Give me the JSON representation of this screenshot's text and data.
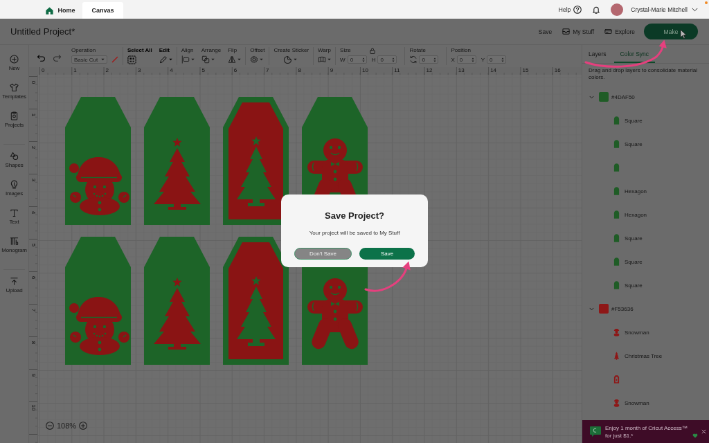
{
  "top_bar": {
    "tabs": [
      {
        "kind": "home",
        "label": "Home",
        "selected": false
      },
      {
        "kind": "canvas",
        "label": "Canvas",
        "selected": true
      }
    ],
    "help": "Help",
    "user_name": "Crystal-Marie Mitchell"
  },
  "project_bar": {
    "title": "Untitled Project*",
    "actions": [
      {
        "kind": "save",
        "label": "Save"
      },
      {
        "kind": "my_stuff",
        "label": "My Stuff"
      },
      {
        "kind": "explore",
        "label": "Explore"
      }
    ],
    "make_button": "Make"
  },
  "toolbar": {
    "history": [
      {
        "kind": "undo",
        "disabled": false
      },
      {
        "kind": "redo",
        "disabled": true
      }
    ],
    "sections": [
      {
        "tools": [
          {
            "kind": "operation",
            "label": "Operation",
            "disabled": true,
            "value": "Basic Cut"
          }
        ]
      },
      {
        "tools": [
          {
            "kind": "select_all",
            "label": "Select All",
            "disabled": false
          },
          {
            "kind": "edit",
            "label": "Edit",
            "disabled": false
          }
        ]
      },
      {
        "tools": [
          {
            "kind": "align",
            "label": "Align",
            "disabled": true
          },
          {
            "kind": "arrange",
            "label": "Arrange",
            "disabled": true
          },
          {
            "kind": "flip",
            "label": "Flip",
            "disabled": true
          }
        ]
      },
      {
        "tools": [
          {
            "kind": "offset",
            "label": "Offset",
            "disabled": true
          }
        ]
      },
      {
        "tools": [
          {
            "kind": "sticker",
            "label": "Create Sticker",
            "disabled": true
          }
        ]
      },
      {
        "tools": [
          {
            "kind": "warp",
            "label": "Warp",
            "disabled": true
          }
        ]
      },
      {
        "tools": [
          {
            "kind": "size",
            "label": "Size",
            "disabled": true,
            "fields": [
              {
                "prefix": "W",
                "value": "0"
              },
              {
                "prefix": "H",
                "value": "0"
              }
            ]
          }
        ]
      },
      {
        "tools": [
          {
            "kind": "rotate",
            "label": "Rotate",
            "disabled": true,
            "fields": [
              {
                "value": "0"
              }
            ]
          }
        ]
      },
      {
        "tools": [
          {
            "kind": "position",
            "label": "Position",
            "disabled": true,
            "fields": [
              {
                "prefix": "X",
                "value": "0"
              },
              {
                "prefix": "Y",
                "value": "0"
              }
            ]
          }
        ]
      }
    ]
  },
  "sidebar": {
    "sections": [
      {
        "items": [
          {
            "kind": "new",
            "label": "New"
          },
          {
            "kind": "templates",
            "label": "Templates"
          },
          {
            "kind": "projects",
            "label": "Projects"
          }
        ]
      },
      {
        "items": [
          {
            "kind": "shapes",
            "label": "Shapes"
          },
          {
            "kind": "images",
            "label": "Images"
          },
          {
            "kind": "text",
            "label": "Text"
          },
          {
            "kind": "monogram",
            "label": "Monogram"
          }
        ]
      },
      {
        "items": [
          {
            "kind": "upload",
            "label": "Upload"
          }
        ]
      }
    ]
  },
  "rulers": {
    "horizontal": [
      "0",
      "1",
      "2",
      "3",
      "4",
      "5",
      "6",
      "7",
      "8",
      "9",
      "10",
      "11",
      "12",
      "13",
      "14",
      "15",
      "16"
    ],
    "vertical": [
      "0",
      "1",
      "2",
      "3",
      "4",
      "5",
      "6",
      "7",
      "8",
      "9",
      "10"
    ]
  },
  "canvas": {
    "tags": [
      {
        "kind": "snowman"
      },
      {
        "kind": "tree"
      },
      {
        "kind": "framed_tree"
      },
      {
        "kind": "gingerbread"
      },
      {
        "kind": "snowman"
      },
      {
        "kind": "tree"
      },
      {
        "kind": "framed_tree"
      },
      {
        "kind": "gingerbread"
      }
    ],
    "zoom": "108%"
  },
  "dialog": {
    "title": "Save Project?",
    "message": "Your project will be saved to My Stuff",
    "buttons": [
      {
        "kind": "dont_save",
        "label": "Don't Save"
      },
      {
        "kind": "save",
        "label": "Save"
      }
    ]
  },
  "panel": {
    "tabs": [
      {
        "label": "Layers",
        "selected": false
      },
      {
        "label": "Color Sync",
        "selected": true
      }
    ],
    "hint": "Drag and drop layers to consolidate material colors.",
    "groups": [
      {
        "name": "#4DAF50",
        "color": "#1f5c26",
        "expanded": true,
        "layers": [
          {
            "kind": "tag",
            "label": "Square"
          },
          {
            "kind": "tag",
            "label": "Square"
          },
          {
            "kind": "tag"
          },
          {
            "kind": "tag",
            "label": "Hexagon"
          },
          {
            "kind": "tag",
            "label": "Hexagon"
          },
          {
            "kind": "tag",
            "label": "Square"
          },
          {
            "kind": "tag",
            "label": "Square"
          },
          {
            "kind": "tag",
            "label": "Square"
          }
        ]
      },
      {
        "name": "#F53636",
        "color": "#8e1717",
        "expanded": true,
        "layers": [
          {
            "kind": "snowman",
            "label": "Snowman"
          },
          {
            "kind": "tree",
            "label": "Christmas Tree"
          },
          {
            "kind": "framed_tag"
          },
          {
            "kind": "snowman",
            "label": "Snowman"
          }
        ]
      }
    ]
  },
  "promo": {
    "text": "Enjoy 1 month of Cricut Access™ for just $1.*"
  }
}
